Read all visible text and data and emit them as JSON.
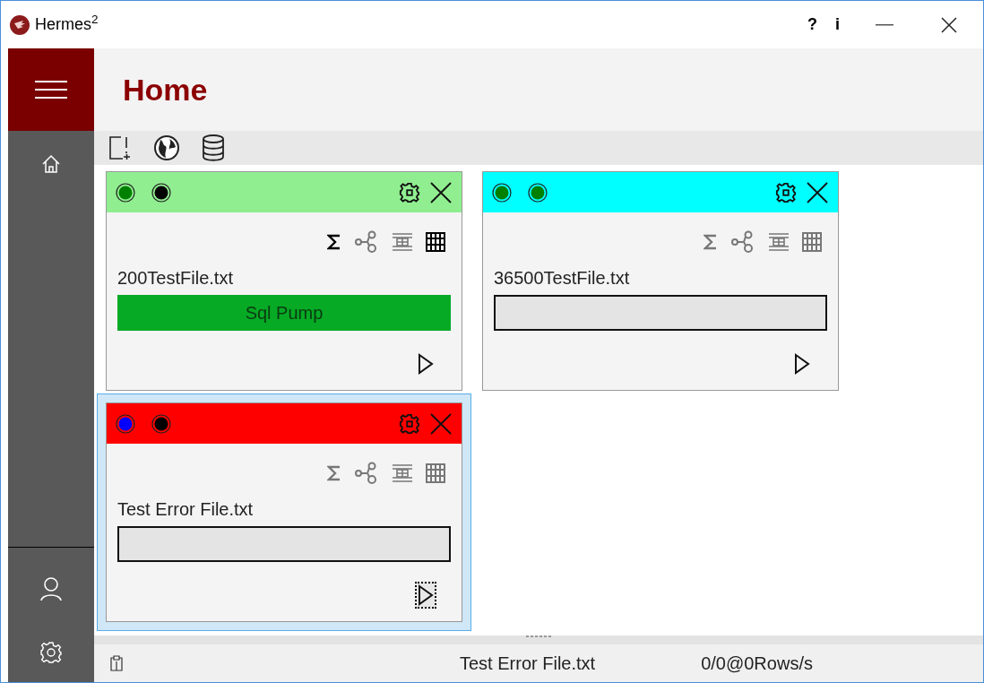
{
  "window": {
    "title": "Hermes$^{2}$",
    "buttons": [
      "?",
      "i"
    ]
  },
  "page": {
    "title": "Home"
  },
  "cards": [
    {
      "color": "#90ee90",
      "selected": false,
      "dots": [
        {
          "color": "#008000"
        },
        {
          "color": "#000000"
        }
      ],
      "tools": [
        {
          "kind": "sum",
          "enabled": true
        },
        {
          "kind": "graph",
          "enabled": false
        },
        {
          "kind": "frame",
          "enabled": false
        },
        {
          "kind": "grid",
          "enabled": true
        }
      ],
      "file": "200TestFile.txt",
      "progress": {
        "label": "Sql Pump",
        "level": 1
      },
      "play_focused": false
    },
    {
      "color": "#00ffff",
      "selected": false,
      "dots": [
        {
          "color": "#008000"
        },
        {
          "color": "#008000"
        }
      ],
      "tools": [
        {
          "kind": "sum",
          "enabled": false
        },
        {
          "kind": "graph",
          "enabled": false
        },
        {
          "kind": "frame",
          "enabled": false
        },
        {
          "kind": "grid",
          "enabled": false
        }
      ],
      "file": "36500TestFile.txt",
      "progress": {
        "level": 0
      },
      "play_focused": false
    },
    {
      "color": "#ff0000",
      "selected": true,
      "dots": [
        {
          "color": "#0000ff"
        },
        {
          "color": "#000000"
        }
      ],
      "tools": [
        {
          "kind": "sum",
          "enabled": false
        },
        {
          "kind": "graph",
          "enabled": false
        },
        {
          "kind": "frame",
          "enabled": false
        },
        {
          "kind": "grid",
          "enabled": false
        }
      ],
      "file": "Test Error File.txt",
      "progress": {
        "level": 0
      },
      "play_focused": true
    }
  ],
  "status_bar": {
    "file": "Test Error File.txt",
    "rate": "0/0@0Rows/s"
  }
}
